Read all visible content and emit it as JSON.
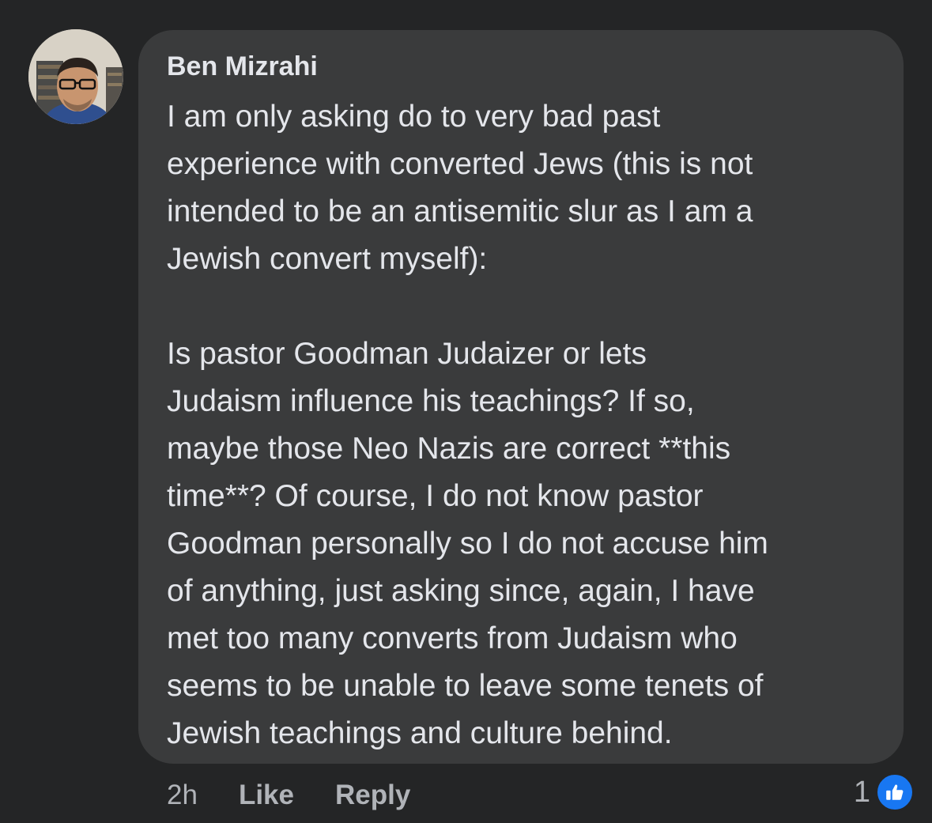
{
  "comment": {
    "author": "Ben Mizrahi",
    "text": "I am only asking do to very bad past\nexperience with converted Jews (this is not\nintended to be an antisemitic slur as I am a\nJewish convert myself):\n\nIs pastor Goodman Judaizer or lets\nJudaism influence his teachings? If so,\nmaybe those Neo Nazis are correct **this\ntime**? Of course, I do not know pastor\nGoodman personally so I do not accuse him\nof anything, just asking since, again, I have\nmet too many converts from Judaism who\nseems to be unable to leave some tenets of\nJewish teachings and culture behind.",
    "timestamp": "2h",
    "like_label": "Like",
    "reply_label": "Reply",
    "reaction_count": "1",
    "reaction_icon": "thumbs-up-icon"
  },
  "colors": {
    "background": "#242526",
    "bubble": "#3a3b3c",
    "text": "#e4e6eb",
    "secondary_text": "#b0b3b8",
    "like_blue": "#1877f2"
  }
}
